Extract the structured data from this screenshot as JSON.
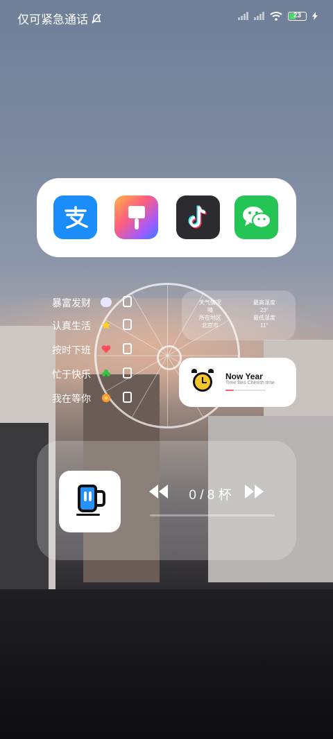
{
  "status_bar": {
    "carrier_text": "仅可紧急通话",
    "battery_level": "23",
    "icons": [
      "bell-off-icon",
      "signal-icon",
      "signal-icon",
      "wifi-icon",
      "battery-icon",
      "charging-icon"
    ]
  },
  "dock": {
    "apps": [
      {
        "name": "alipay",
        "icon": "alipay-icon",
        "color": "#1a8dfb"
      },
      {
        "name": "paint",
        "icon": "brush-icon",
        "color": "#ff6f7e"
      },
      {
        "name": "tiktok",
        "icon": "tiktok-icon",
        "color": "#2c2c30"
      },
      {
        "name": "wechat",
        "icon": "wechat-icon",
        "color": "#24c554"
      }
    ]
  },
  "habits": [
    {
      "label": "暴富发财",
      "icon": "cloud-icon",
      "color": "#e8e6ff"
    },
    {
      "label": "认真生活",
      "icon": "star-icon",
      "color": "#ffd21f"
    },
    {
      "label": "按时下班",
      "icon": "heart-icon",
      "color": "#ff4b5c"
    },
    {
      "label": "忙于快乐",
      "icon": "clover-icon",
      "color": "#3cc04a"
    },
    {
      "label": "我在等你",
      "icon": "flower-icon",
      "color": "#ff9a2e"
    }
  ],
  "weather": {
    "col1": {
      "label1": "天气情况",
      "value1": "晴",
      "label2": "所在地区",
      "value2": "北京市"
    },
    "col2": {
      "label1": "最高温度",
      "value1": "23°",
      "label2": "最低温度",
      "value2": "11°"
    }
  },
  "now_year": {
    "title": "Now Year",
    "subtitle": "Time flies Cherish time",
    "progress": 0.2,
    "accent": "#ff5a6e"
  },
  "water": {
    "current": "0",
    "total": "/ 8 杯",
    "progress": 0,
    "accent": "#2592ff"
  }
}
